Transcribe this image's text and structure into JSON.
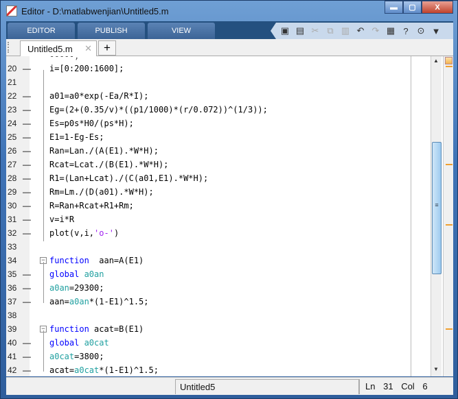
{
  "window": {
    "title": "Editor - D:\\matlabwenjian\\Untitled5.m",
    "minimize": "▬",
    "maximize": "▢",
    "close": "X"
  },
  "toolstrip": {
    "tabs": [
      "EDITOR",
      "PUBLISH",
      "VIEW"
    ],
    "tools": [
      {
        "icon": "new-icon",
        "glyph": "▣"
      },
      {
        "icon": "save-icon",
        "glyph": "▤"
      },
      {
        "icon": "cut-icon",
        "glyph": "✂",
        "disabled": true
      },
      {
        "icon": "copy-icon",
        "glyph": "⧉",
        "disabled": true
      },
      {
        "icon": "paste-icon",
        "glyph": "▥",
        "disabled": true
      },
      {
        "icon": "undo-icon",
        "glyph": "↶"
      },
      {
        "icon": "redo-icon",
        "glyph": "↷",
        "disabled": true
      },
      {
        "icon": "switch-windows-icon",
        "glyph": "▦"
      },
      {
        "icon": "help-icon",
        "glyph": "?"
      },
      {
        "icon": "search-docs-icon",
        "glyph": "⊙"
      },
      {
        "icon": "expand-toolstrip-icon",
        "glyph": "▼"
      }
    ]
  },
  "doc_tabs": {
    "active": "Untitled5.m",
    "close": "✕",
    "add": "+"
  },
  "colors": {
    "keyword": "#0000ff",
    "variable": "#20a0a0",
    "string": "#a020f0"
  },
  "code": [
    {
      "n": "20",
      "dash": true,
      "segs": [
        {
          "t": "i=[0:200:1600];"
        }
      ]
    },
    {
      "n": "21",
      "dash": false,
      "segs": []
    },
    {
      "n": "22",
      "dash": true,
      "segs": [
        {
          "t": "a01=a0*exp(-Ea/R*I);"
        }
      ]
    },
    {
      "n": "23",
      "dash": true,
      "segs": [
        {
          "t": "Eg=(2+(0.35/v)*((p1/1000)*(r/0.072))^(1/3));"
        }
      ]
    },
    {
      "n": "24",
      "dash": true,
      "segs": [
        {
          "t": "Es=p0s*H0/(ps*H);"
        }
      ]
    },
    {
      "n": "25",
      "dash": true,
      "segs": [
        {
          "t": "E1=1-Eg-Es;"
        }
      ]
    },
    {
      "n": "26",
      "dash": true,
      "segs": [
        {
          "t": "Ran=Lan./(A(E1).*W*H);"
        }
      ]
    },
    {
      "n": "27",
      "dash": true,
      "segs": [
        {
          "t": "Rcat=Lcat./(B(E1).*W*H);"
        }
      ]
    },
    {
      "n": "28",
      "dash": true,
      "segs": [
        {
          "t": "R1=(Lan+Lcat)./(C(a01,E1).*W*H);"
        }
      ]
    },
    {
      "n": "29",
      "dash": true,
      "segs": [
        {
          "t": "Rm=Lm./(D(a01).*W*H);"
        }
      ]
    },
    {
      "n": "30",
      "dash": true,
      "segs": [
        {
          "t": "R=Ran+Rcat+R1+Rm;"
        }
      ]
    },
    {
      "n": "31",
      "dash": true,
      "segs": [
        {
          "t": "v=i*R"
        }
      ]
    },
    {
      "n": "32",
      "dash": true,
      "segs": [
        {
          "t": "plot(v,i,"
        },
        {
          "t": "'o-'",
          "c": "string"
        },
        {
          "t": ")"
        }
      ]
    },
    {
      "n": "33",
      "dash": false,
      "segs": []
    },
    {
      "n": "34",
      "dash": false,
      "fold": true,
      "segs": [
        {
          "t": "function",
          "c": "keyword"
        },
        {
          "t": "  aan=A(E1)"
        }
      ]
    },
    {
      "n": "35",
      "dash": true,
      "segs": [
        {
          "t": "global ",
          "c": "keyword"
        },
        {
          "t": "a0an",
          "c": "variable"
        }
      ]
    },
    {
      "n": "36",
      "dash": true,
      "segs": [
        {
          "t": "a0an",
          "c": "variable"
        },
        {
          "t": "=29300;"
        }
      ]
    },
    {
      "n": "37",
      "dash": true,
      "segs": [
        {
          "t": "aan="
        },
        {
          "t": "a0an",
          "c": "variable"
        },
        {
          "t": "*(1-E1)^1.5;"
        }
      ]
    },
    {
      "n": "38",
      "dash": false,
      "segs": []
    },
    {
      "n": "39",
      "dash": false,
      "fold": true,
      "segs": [
        {
          "t": "function",
          "c": "keyword"
        },
        {
          "t": " acat=B(E1)"
        }
      ]
    },
    {
      "n": "40",
      "dash": true,
      "segs": [
        {
          "t": "global ",
          "c": "keyword"
        },
        {
          "t": "a0cat",
          "c": "variable"
        }
      ]
    },
    {
      "n": "41",
      "dash": true,
      "segs": [
        {
          "t": "a0cat",
          "c": "variable"
        },
        {
          "t": "=3800;"
        }
      ]
    },
    {
      "n": "42",
      "dash": true,
      "segs": [
        {
          "t": "acat="
        },
        {
          "t": "a0cat",
          "c": "variable"
        },
        {
          "t": "*(1-E1)^1.5;"
        }
      ]
    }
  ],
  "scrollbar": {
    "position_fraction": 0.45
  },
  "status": {
    "file": "Untitled5",
    "ln_label": "Ln",
    "ln": "31",
    "col_label": "Col",
    "col": "6"
  }
}
